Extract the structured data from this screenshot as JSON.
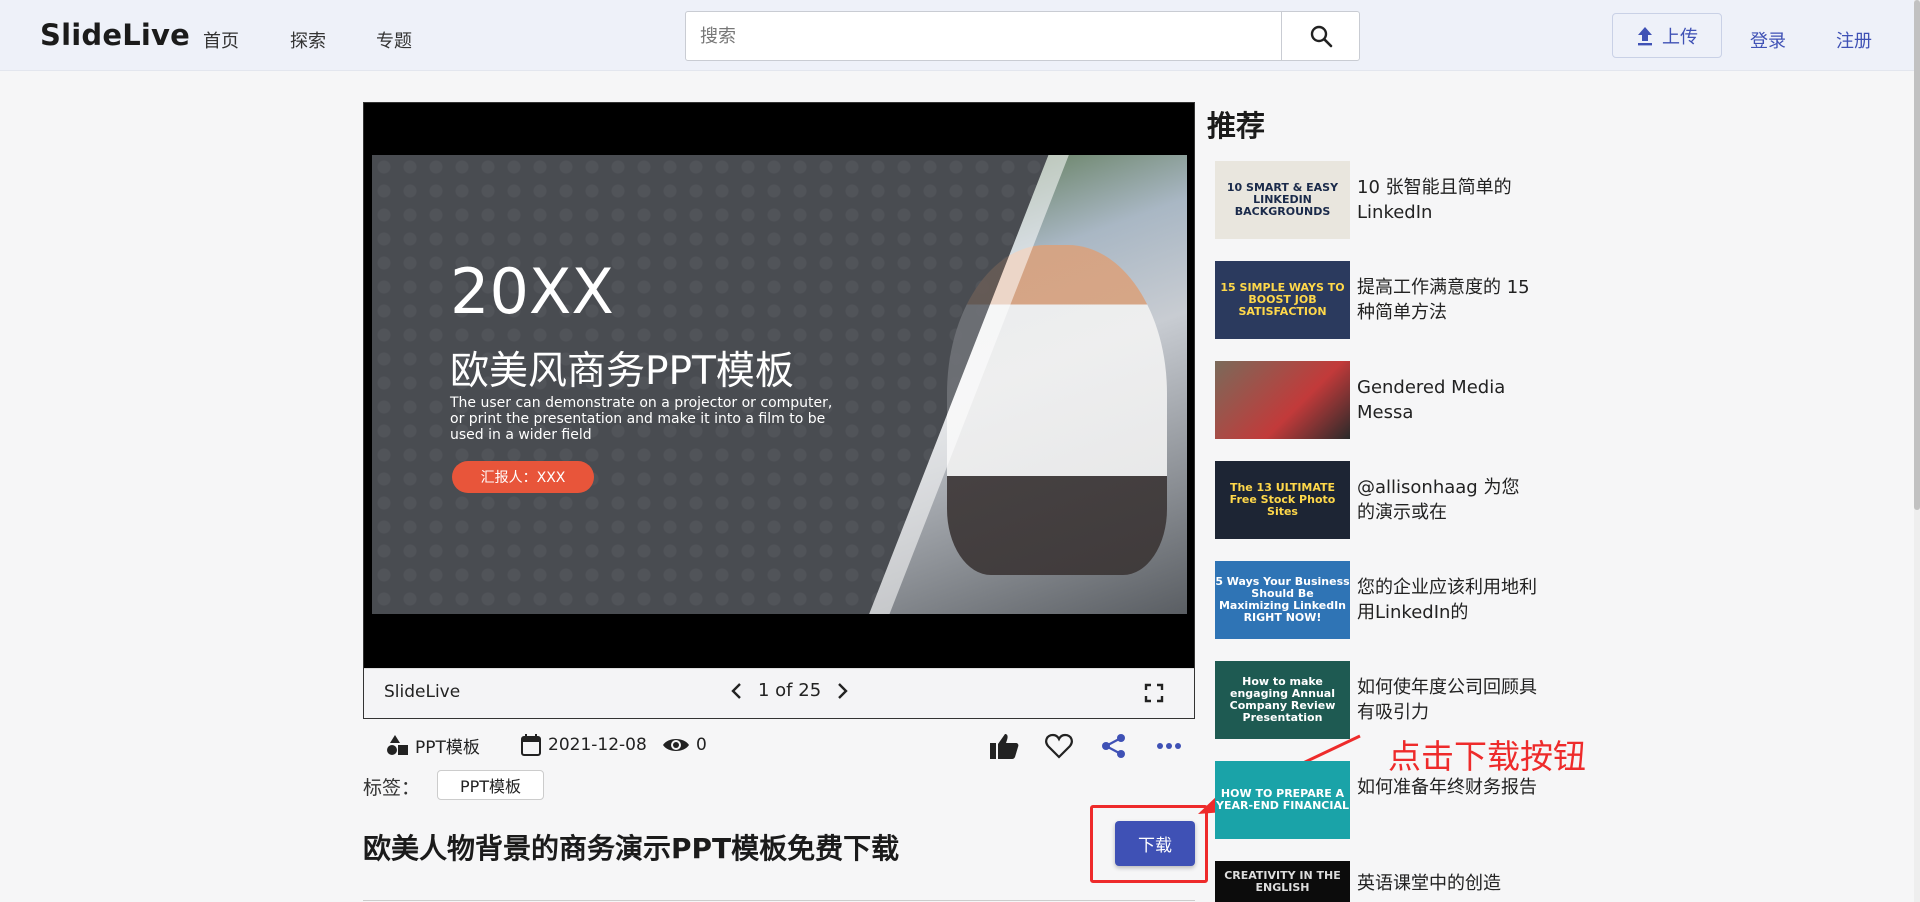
{
  "header": {
    "brand": "SlideLive",
    "nav": [
      "首页",
      "探索",
      "专题"
    ],
    "search_placeholder": "搜索",
    "upload_label": "上传",
    "login_label": "登录",
    "register_label": "注册",
    "accent_color": "#3f51b5"
  },
  "viewer": {
    "slide": {
      "year": "20XX",
      "title": "欧美风商务PPT模板",
      "subtitle": "The user can demonstrate on a projector or computer, or print the presentation and make it into a film to be used in a wider field",
      "reporter": "汇报人：XXX"
    },
    "brand": "SlideLive",
    "page_indicator": "1 of 25"
  },
  "meta": {
    "category": "PPT模板",
    "date": "2021-12-08",
    "views": "0"
  },
  "tags": {
    "label": "标签：",
    "items": [
      "PPT模板"
    ]
  },
  "page": {
    "title": "欧美人物背景的商务演示PPT模板免费下载",
    "download_label": "下载"
  },
  "annotation": {
    "text": "点击下载按钮",
    "color": "#ee2b2b"
  },
  "recommend": {
    "heading": "推荐",
    "items": [
      {
        "title": "10 张智能且简单的 LinkedIn",
        "thumb_text": "10 SMART & EASY LINKEDIN BACKGROUNDS"
      },
      {
        "title": "提高工作满意度的 15 种简单方法",
        "thumb_text": "15 SIMPLE WAYS TO BOOST JOB SATISFACTION"
      },
      {
        "title": "Gendered Media Messa",
        "thumb_text": ""
      },
      {
        "title": "@allisonhaag 为您的演示或在",
        "thumb_text": "The 13 ULTIMATE Free Stock Photo Sites"
      },
      {
        "title": "您的企业应该利用地利用LinkedIn的",
        "thumb_text": "5 Ways Your Business Should Be Maximizing LinkedIn RIGHT NOW!"
      },
      {
        "title": "如何使年度公司回顾具有吸引力",
        "thumb_text": "How to make engaging Annual Company Review Presentation"
      },
      {
        "title": "如何准备年终财务报告",
        "thumb_text": "HOW TO PREPARE A YEAR-END FINANCIAL"
      },
      {
        "title": "英语课堂中的创造",
        "thumb_text": "CREATIVITY IN THE ENGLISH"
      }
    ]
  }
}
